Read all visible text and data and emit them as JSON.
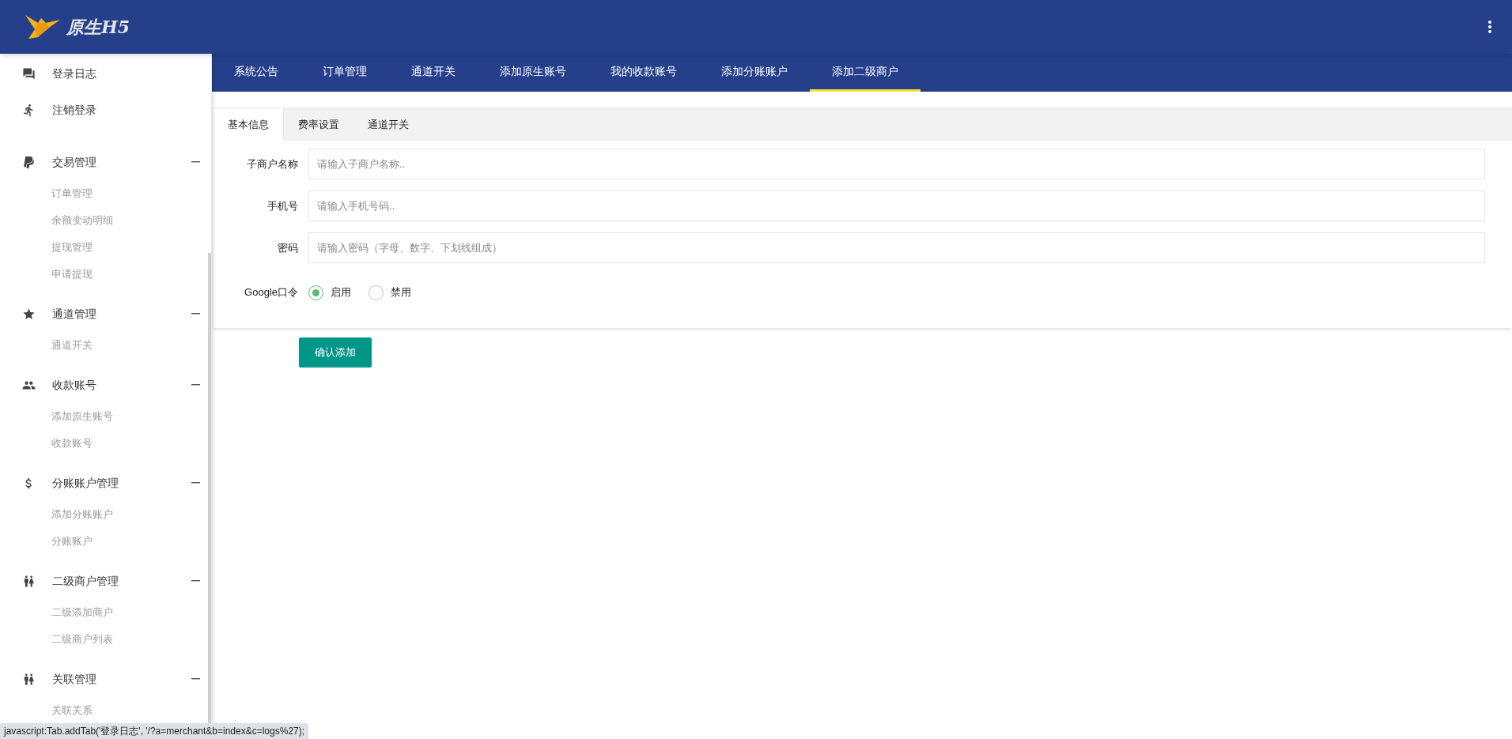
{
  "header": {
    "logo_text": "原生H5"
  },
  "sidebar": {
    "items": [
      {
        "label": "登录日志"
      },
      {
        "label": "注销登录"
      },
      {
        "label": "交易管理",
        "expanded": true,
        "children": [
          {
            "label": "订单管理"
          },
          {
            "label": "余额变动明细"
          },
          {
            "label": "提现管理"
          },
          {
            "label": "申请提现"
          }
        ]
      },
      {
        "label": "通道管理",
        "expanded": true,
        "children": [
          {
            "label": "通道开关"
          }
        ]
      },
      {
        "label": "收款账号",
        "expanded": true,
        "children": [
          {
            "label": "添加原生账号"
          },
          {
            "label": "收款账号"
          }
        ]
      },
      {
        "label": "分账账户管理",
        "expanded": true,
        "children": [
          {
            "label": "添加分账账户"
          },
          {
            "label": "分账账户"
          }
        ]
      },
      {
        "label": "二级商户管理",
        "expanded": true,
        "children": [
          {
            "label": "二级添加商户"
          },
          {
            "label": "二级商户列表"
          }
        ]
      },
      {
        "label": "关联管理",
        "expanded": true,
        "children": [
          {
            "label": "关联关系"
          }
        ]
      }
    ]
  },
  "top_tabs": [
    {
      "label": "系统公告",
      "selected": false
    },
    {
      "label": "订单管理",
      "selected": false
    },
    {
      "label": "通道开关",
      "selected": false
    },
    {
      "label": "添加原生账号",
      "selected": false
    },
    {
      "label": "我的收款账号",
      "selected": false
    },
    {
      "label": "添加分账账户",
      "selected": false
    },
    {
      "label": "添加二级商户",
      "selected": true
    }
  ],
  "form_tabs": [
    {
      "label": "基本信息",
      "selected": true
    },
    {
      "label": "费率设置",
      "selected": false
    },
    {
      "label": "通道开关",
      "selected": false
    }
  ],
  "fields": [
    {
      "label": "子商户名称",
      "placeholder": "请输入子商户名称.."
    },
    {
      "label": "手机号",
      "placeholder": "请输入手机号码.."
    },
    {
      "label": "密码",
      "placeholder": "请输入密码（字母、数字、下划线组成）"
    }
  ],
  "google_token": {
    "label": "Google口令",
    "options": [
      {
        "label": "启用",
        "selected": true
      },
      {
        "label": "禁用",
        "selected": false
      }
    ]
  },
  "submit_button": "确认添加",
  "status_bar": "javascript:Tab.addTab('登录日志', '/?a=merchant&b=index&c=logs%27);"
}
